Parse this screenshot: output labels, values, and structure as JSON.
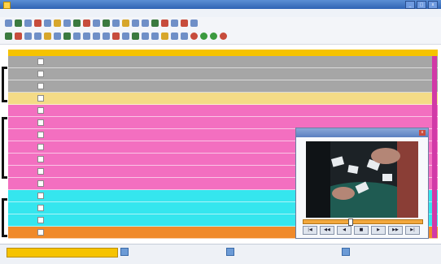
{
  "window": {
    "title": "",
    "min_label": "_",
    "max_label": "□",
    "close_label": "x"
  },
  "menubar": {
    "items": [
      "",
      "",
      "",
      "",
      "",
      "",
      "",
      "",
      "",
      ""
    ]
  },
  "toolbar": {
    "right_label": "",
    "right_btn": ""
  },
  "grid": {
    "columns": [
      "",
      "",
      "",
      "",
      "",
      "",
      "",
      "",
      "",
      "",
      "",
      "",
      "",
      ""
    ],
    "rows": [
      {
        "color": "#a6a6a6",
        "time": "",
        "title1": "",
        "title2": "",
        "d1": "",
        "d2": "",
        "d3": "",
        "d4": "",
        "n1": "",
        "n2": "",
        "last": ""
      },
      {
        "color": "#a6a6a6",
        "time": "",
        "title1": "",
        "title2": "",
        "d1": "",
        "d2": "",
        "d3": "",
        "d4": "",
        "n1": "",
        "n2": "",
        "last": ""
      },
      {
        "color": "#a6a6a6",
        "time": "",
        "title1": "",
        "title2": "",
        "d1": "",
        "d2": "",
        "d3": "",
        "d4": "",
        "n1": "",
        "n2": "",
        "last": ""
      },
      {
        "color": "#f4db86",
        "time": "",
        "title1": "",
        "title2": "",
        "d1": "",
        "d2": "",
        "d3": "",
        "d4": "",
        "n1": "",
        "n2": "",
        "last": ""
      },
      {
        "color": "#f36fc0",
        "time": "",
        "title1": "",
        "title2": "",
        "d1": "",
        "d2": "",
        "d3": "",
        "d4": "",
        "n1": "",
        "n2": "",
        "last": ""
      },
      {
        "color": "#f36fc0",
        "time": "",
        "title1": "",
        "title2": "",
        "d1": "",
        "d2": "",
        "d3": "",
        "d4": "",
        "n1": "",
        "n2": "",
        "last": ""
      },
      {
        "color": "#f36fc0",
        "time": "",
        "title1": "",
        "title2": "",
        "d1": "",
        "d2": "",
        "d3": "",
        "d4": "",
        "n1": "",
        "n2": "",
        "last": ""
      },
      {
        "color": "#f36fc0",
        "time": "",
        "title1": "",
        "title2": "",
        "d1": "",
        "d2": "",
        "d3": "",
        "d4": "",
        "n1": "",
        "n2": "",
        "last": ""
      },
      {
        "color": "#f36fc0",
        "time": "",
        "title1": "",
        "title2": "",
        "d1": "",
        "d2": "",
        "d3": "",
        "d4": "",
        "n1": "",
        "n2": "",
        "last": ""
      },
      {
        "color": "#f36fc0",
        "time": "",
        "title1": "",
        "title2": "",
        "d1": "",
        "d2": "",
        "d3": "",
        "d4": "",
        "n1": "",
        "n2": "",
        "last": ""
      },
      {
        "color": "#f36fc0",
        "time": "",
        "title1": "",
        "title2": "",
        "d1": "",
        "d2": "",
        "d3": "",
        "d4": "",
        "n1": "",
        "n2": "",
        "last": ""
      },
      {
        "color": "#35e6ee",
        "time": "",
        "title1": "",
        "title2": "",
        "d1": "",
        "d2": "",
        "d3": "",
        "d4": "",
        "n1": "",
        "n2": "",
        "last": ""
      },
      {
        "color": "#35e6ee",
        "time": "",
        "title1": "",
        "title2": "",
        "d1": "",
        "d2": "",
        "d3": "",
        "d4": "",
        "n1": "",
        "n2": "",
        "last": ""
      },
      {
        "color": "#35e6ee",
        "time": "",
        "title1": "",
        "title2": "",
        "d1": "",
        "d2": "",
        "d3": "",
        "d4": "",
        "n1": "",
        "n2": "",
        "last": ""
      },
      {
        "color": "#f08a2a",
        "time": "",
        "title1": "",
        "title2": "",
        "d1": "",
        "d2": "",
        "d3": "",
        "d4": "",
        "n1": "",
        "n2": "",
        "last": ""
      }
    ]
  },
  "video_player": {
    "title": "",
    "seek_position": 0.38,
    "controls": [
      "|◀",
      "◀◀",
      "◀",
      "■",
      "▶",
      "▶▶",
      "▶|"
    ]
  },
  "statusbar": {
    "selection": "",
    "documents": [
      "",
      "",
      ""
    ],
    "bottom_left": "",
    "bottom_mid": "",
    "bottom_right": ""
  },
  "colors": {
    "accent_yellow": "#f6c300",
    "pink": "#f36fc0",
    "cyan": "#35e6ee",
    "orange": "#f08a2a",
    "gray": "#a6a6a6",
    "light_yellow": "#f4db86"
  }
}
